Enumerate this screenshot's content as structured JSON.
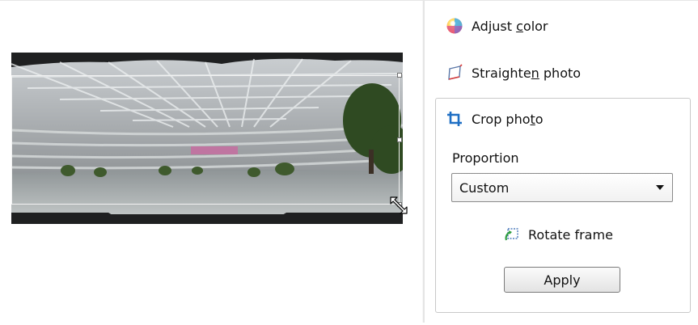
{
  "tools": {
    "adjust_color": {
      "pre": "Adjust ",
      "ul": "c",
      "post": "olor",
      "icon": "color-wheel-icon"
    },
    "straighten": {
      "pre": "Straighte",
      "ul": "n",
      "post": " photo",
      "icon": "straighten-icon"
    }
  },
  "crop": {
    "title_pre": "Crop pho",
    "title_ul": "t",
    "title_post": "o",
    "icon": "crop-icon",
    "proportion_label": "Proportion",
    "proportion_value": "Custom",
    "rotate_label": "Rotate frame",
    "rotate_icon": "rotate-frame-icon",
    "apply_label": "Apply"
  },
  "colors": {
    "panel_border": "#c9c9c9",
    "crop_icon_blue": "#1f6fc4",
    "rotate_icon_green": "#2e9d3e"
  }
}
